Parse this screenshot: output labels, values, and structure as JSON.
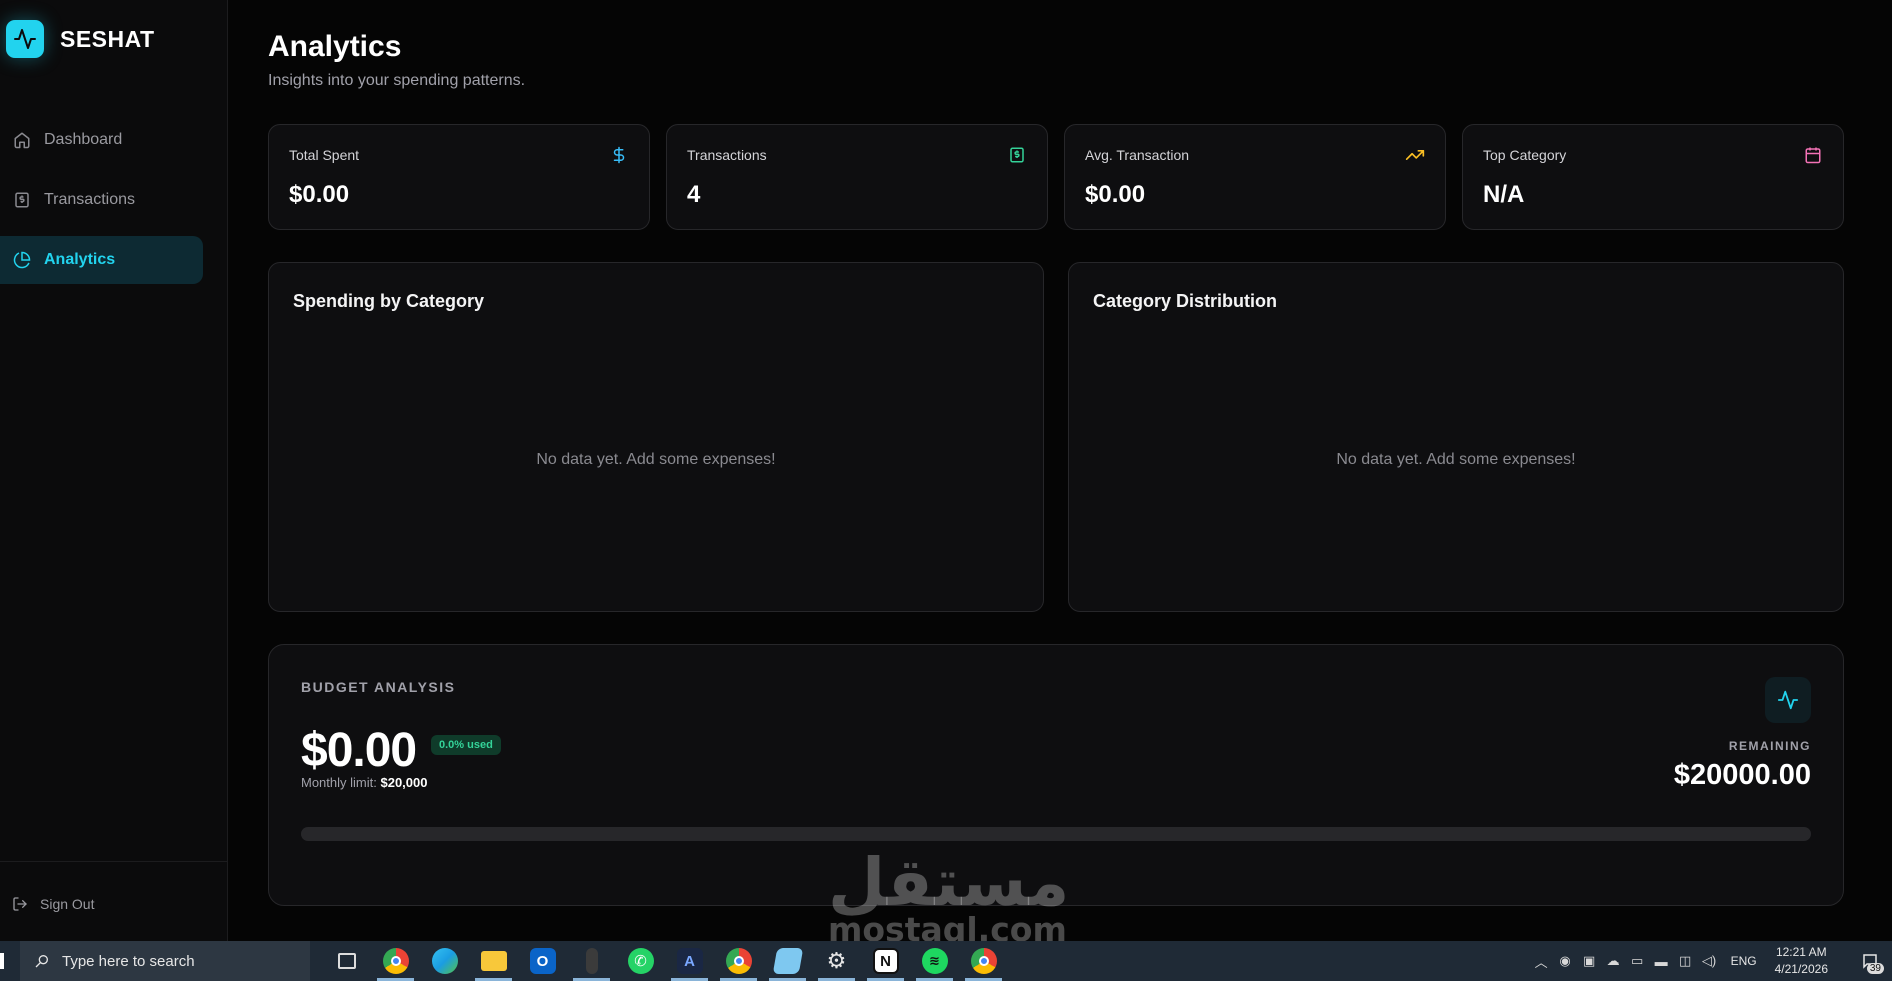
{
  "brand": {
    "name": "SESHAT",
    "accent": "#22d3ee"
  },
  "sidebar": {
    "items": [
      {
        "label": "Dashboard",
        "icon": "home-icon",
        "active": false
      },
      {
        "label": "Transactions",
        "icon": "receipt-icon",
        "active": false
      },
      {
        "label": "Analytics",
        "icon": "pie-chart-icon",
        "active": true
      }
    ],
    "sign_out_label": "Sign Out"
  },
  "header": {
    "title": "Analytics",
    "subtitle": "Insights into your spending patterns."
  },
  "stats": [
    {
      "label": "Total Spent",
      "value": "$0.00",
      "icon": "dollar-icon",
      "color": "#38bdf8"
    },
    {
      "label": "Transactions",
      "value": "4",
      "icon": "banknote-icon",
      "color": "#34d399"
    },
    {
      "label": "Avg. Transaction",
      "value": "$0.00",
      "icon": "trending-up-icon",
      "color": "#fbbf24"
    },
    {
      "label": "Top Category",
      "value": "N/A",
      "icon": "calendar-icon",
      "color": "#f472b6"
    }
  ],
  "charts": [
    {
      "title": "Spending by Category",
      "empty_text": "No data yet. Add some expenses!"
    },
    {
      "title": "Category Distribution",
      "empty_text": "No data yet. Add some expenses!"
    }
  ],
  "budget": {
    "title": "BUDGET ANALYSIS",
    "amount": "$0.00",
    "badge": "0.0% used",
    "limit_label": "Monthly limit:",
    "limit_value": "$20,000",
    "remaining_label": "REMAINING",
    "remaining_value": "$20000.00",
    "used_fraction": 0.0,
    "icon": "activity-icon"
  },
  "watermark": {
    "arabic": "مستقل",
    "latin": "mostaql.com"
  },
  "taskbar": {
    "search_placeholder": "Type here to search",
    "apps": [
      {
        "name": "task-view-icon",
        "open": false
      },
      {
        "name": "chrome-icon",
        "open": true
      },
      {
        "name": "edge-icon",
        "open": false
      },
      {
        "name": "file-explorer-icon",
        "open": true
      },
      {
        "name": "outlook-icon",
        "open": false
      },
      {
        "name": "app-dark-icon",
        "open": true
      },
      {
        "name": "whatsapp-icon",
        "open": false
      },
      {
        "name": "affinity-icon",
        "open": true
      },
      {
        "name": "chrome-profile-icon",
        "open": true
      },
      {
        "name": "notepad-icon",
        "open": true
      },
      {
        "name": "settings-icon",
        "open": true
      },
      {
        "name": "notion-icon",
        "open": true
      },
      {
        "name": "spotify-icon",
        "open": true
      },
      {
        "name": "chrome-profile-2-icon",
        "open": true
      }
    ],
    "language": "ENG",
    "time": "12:21 AM",
    "date": "4/21/2026",
    "notification_count": "39"
  }
}
